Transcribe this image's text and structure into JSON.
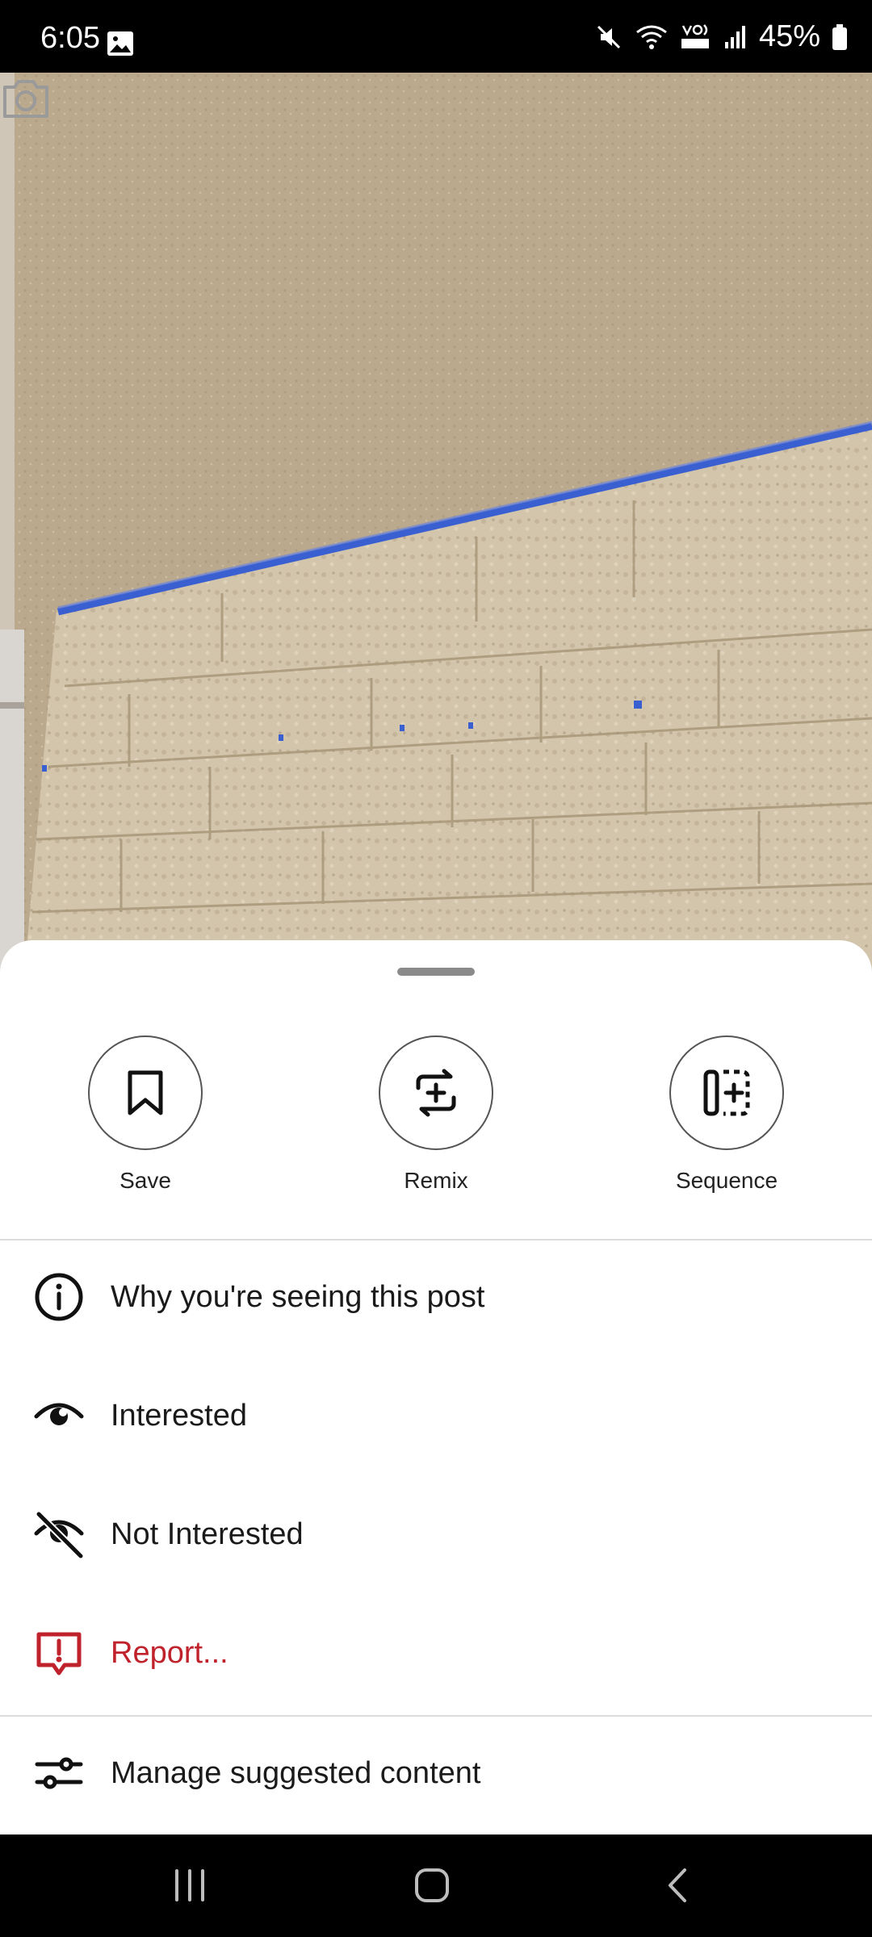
{
  "status_bar": {
    "time": "6:05",
    "battery": "45%",
    "icons": [
      "image-icon",
      "mute-icon",
      "wifi-icon",
      "volte-icon",
      "signal-icon",
      "battery-icon"
    ]
  },
  "photo": {
    "camera_icon": "camera-icon"
  },
  "sheet": {
    "actions": [
      {
        "label": "Save",
        "icon": "bookmark-icon"
      },
      {
        "label": "Remix",
        "icon": "remix-icon"
      },
      {
        "label": "Sequence",
        "icon": "sequence-icon"
      }
    ],
    "menu": [
      {
        "label": "Why you're seeing this post",
        "icon": "info-icon"
      },
      {
        "label": "Interested",
        "icon": "eye-icon"
      },
      {
        "label": "Not Interested",
        "icon": "eye-off-icon"
      },
      {
        "label": "Report...",
        "icon": "report-icon",
        "color": "#c0222c"
      },
      {
        "label": "Manage suggested content",
        "icon": "sliders-icon"
      }
    ]
  },
  "nav_bar": {
    "buttons": [
      "recents-icon",
      "home-icon",
      "back-icon"
    ]
  }
}
